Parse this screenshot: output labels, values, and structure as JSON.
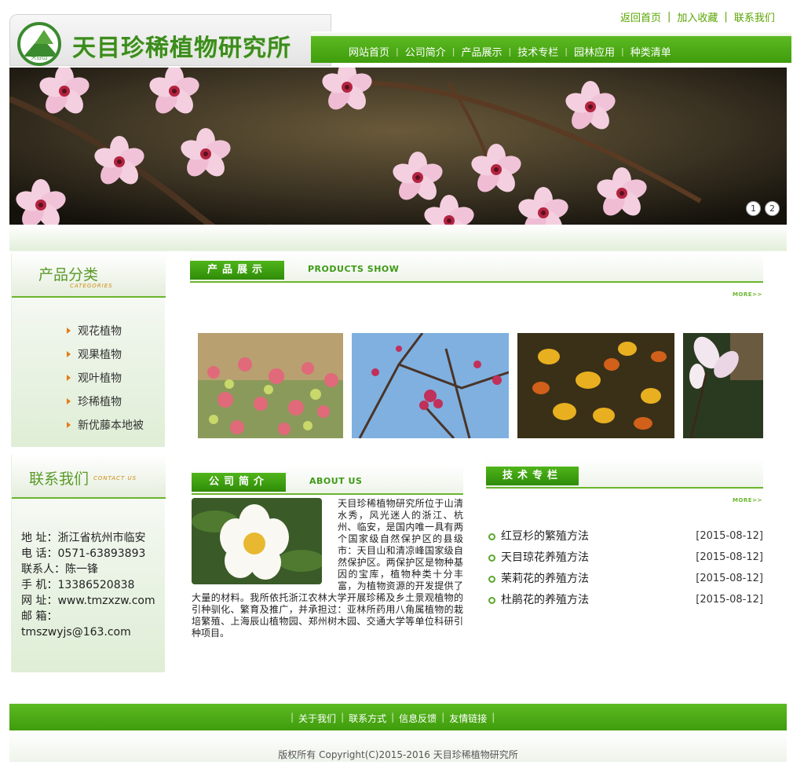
{
  "site": {
    "title": "天目珍稀植物研究所",
    "logo_caption": "天目山"
  },
  "toplinks": [
    "返回首页",
    "加入收藏",
    "联系我们"
  ],
  "nav": [
    "网站首页",
    "公司简介",
    "产品展示",
    "技术专栏",
    "园林应用",
    "种类清单"
  ],
  "banner": {
    "pager": [
      "1",
      "2"
    ]
  },
  "categories": {
    "title": "产品分类",
    "subtitle": "CATEGORIES",
    "items": [
      "观花植物",
      "观果植物",
      "观叶植物",
      "珍稀植物",
      "新优藤本地被"
    ]
  },
  "contact": {
    "title": "联系我们",
    "subtitle": "CONTACT US",
    "lines": [
      "地 址：浙江省杭州市临安",
      "电 话：0571-63893893",
      "联系人：陈一锋",
      "手 机：13386520838",
      "网 址：www.tmzxzw.com",
      "邮 箱：",
      "tmszwyjs@163.com"
    ]
  },
  "products": {
    "tag": "产品展示",
    "en": "PRODUCTS SHOW",
    "more": "MORE>>"
  },
  "about": {
    "tag": "公司简介",
    "en": "ABOUT US",
    "text": "天目珍稀植物研究所位于山清水秀，风光迷人的浙江、杭州、临安，是国内唯一具有两个国家级自然保护区的县级市：天目山和清凉峰国家级自然保护区。两保护区是物种基因的宝库，植物种类十分丰富，为植物资源的开发提供了大量的材料。我所依托浙江农林大学开展珍稀及乡土景观植物的引种驯化、繁育及推广，并承担过：亚林所药用八角属植物的栽培繁殖、上海辰山植物园、郑州树木园、交通大学等单位科研引种项目。"
  },
  "tech": {
    "tag": "技术专栏",
    "more": "MORE>>",
    "items": [
      {
        "title": "红豆杉的繁殖方法",
        "date": "[2015-08-12]"
      },
      {
        "title": "天目琼花养殖方法",
        "date": "[2015-08-12]"
      },
      {
        "title": "茉莉花的养殖方法",
        "date": "[2015-08-12]"
      },
      {
        "title": "杜鹃花的养殖方法",
        "date": "[2015-08-12]"
      }
    ]
  },
  "footer": {
    "links": [
      "关于我们",
      "联系方式",
      "信息反馈",
      "友情链接"
    ],
    "copyright": "版权所有  Copyright(C)2015-2016 天目珍稀植物研究所"
  },
  "colors": {
    "brand_green": "#4aa611",
    "accent_orange": "#e57b10"
  }
}
